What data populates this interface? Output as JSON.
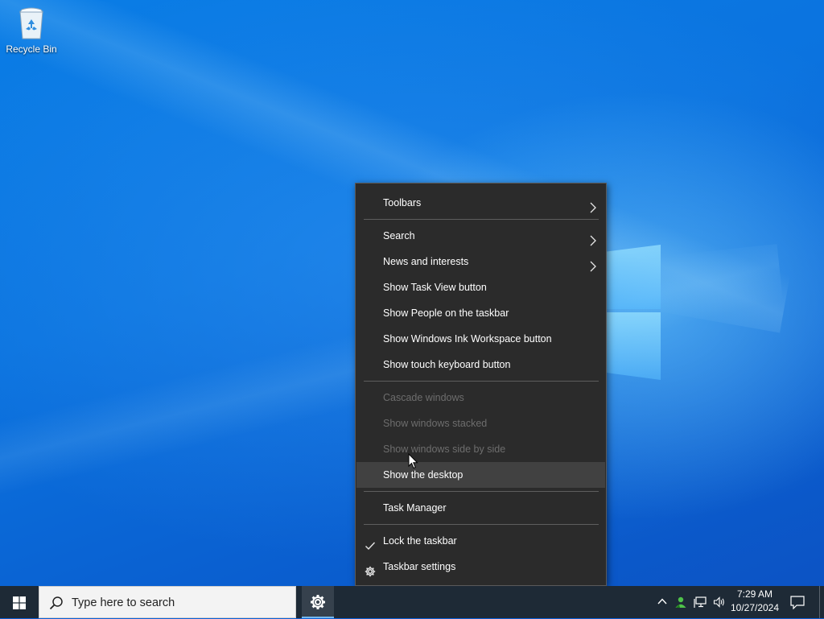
{
  "desktop": {
    "icons": [
      {
        "label": "Recycle Bin",
        "icon": "recycle-bin-icon"
      }
    ]
  },
  "context_menu": {
    "groups": [
      [
        {
          "label": "Toolbars",
          "submenu": true,
          "enabled": true
        }
      ],
      [
        {
          "label": "Search",
          "submenu": true,
          "enabled": true
        },
        {
          "label": "News and interests",
          "submenu": true,
          "enabled": true
        },
        {
          "label": "Show Task View button",
          "enabled": true
        },
        {
          "label": "Show People on the taskbar",
          "enabled": true
        },
        {
          "label": "Show Windows Ink Workspace button",
          "enabled": true
        },
        {
          "label": "Show touch keyboard button",
          "enabled": true
        }
      ],
      [
        {
          "label": "Cascade windows",
          "enabled": false
        },
        {
          "label": "Show windows stacked",
          "enabled": false
        },
        {
          "label": "Show windows side by side",
          "enabled": false
        },
        {
          "label": "Show the desktop",
          "enabled": true,
          "hovered": true
        }
      ],
      [
        {
          "label": "Task Manager",
          "enabled": true
        }
      ],
      [
        {
          "label": "Lock the taskbar",
          "enabled": true,
          "checked": true
        },
        {
          "label": "Taskbar settings",
          "enabled": true,
          "icon": "gear-icon"
        }
      ]
    ]
  },
  "taskbar": {
    "start_icon": "windows-logo-icon",
    "search": {
      "placeholder": "Type here to search",
      "icon": "search-icon"
    },
    "pinned": [
      {
        "icon": "gear-icon",
        "active": true
      }
    ],
    "tray": {
      "icons": [
        "chevron-up-icon",
        "people-icon",
        "network-icon",
        "volume-icon"
      ],
      "time": "7:29 AM",
      "date": "10/27/2024",
      "notification_icon": "action-center-icon"
    }
  },
  "colors": {
    "menu_bg": "#2b2b2b",
    "menu_hover": "#414141",
    "menu_text": "#ffffff",
    "menu_disabled": "#6d6d6d",
    "taskbar_bg": "#1e2a36",
    "accent": "#76b9ed"
  }
}
